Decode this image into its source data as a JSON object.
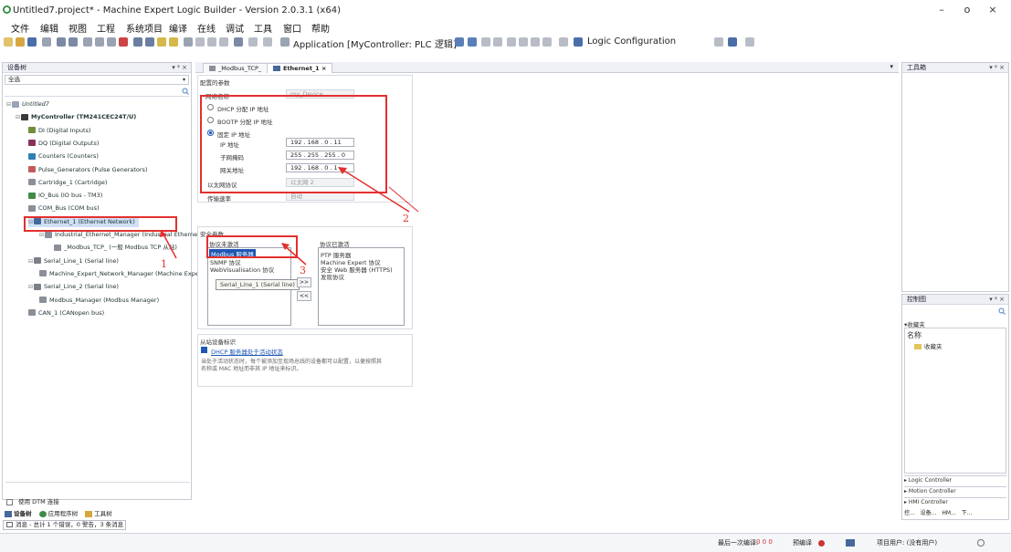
{
  "window": {
    "title": "Untitled7.project* - Machine Expert Logic Builder - Version 2.0.3.1 (x64)",
    "min": "–",
    "max": "o",
    "close": "×"
  },
  "menu": [
    "文件",
    "编辑",
    "视图",
    "工程",
    "系统项目",
    "编译",
    "在线",
    "调试",
    "工具",
    "窗口",
    "帮助"
  ],
  "toolbar": {
    "application": "Application [MyController: PLC 逻辑]",
    "logic_config": "Logic Configuration"
  },
  "left": {
    "title": "设备树",
    "controls": "▾ ᵠ ×",
    "filter": "全选",
    "tree": [
      {
        "label": "Untitled7",
        "level": 0,
        "icon": "project-icon",
        "color": "#9aa4b5"
      },
      {
        "label": "MyController (TM241CEC24T/U)",
        "level": 1,
        "icon": "controller-icon",
        "color": "#3a3a3a",
        "bold": true
      },
      {
        "label": "DI (Digital Inputs)",
        "level": 2,
        "icon": "di-icon",
        "color": "#6f8f3a"
      },
      {
        "label": "DQ (Digital Outputs)",
        "level": 2,
        "icon": "dq-icon",
        "color": "#8b2f5c"
      },
      {
        "label": "Counters (Counters)",
        "level": 2,
        "icon": "counter-icon",
        "color": "#2f7fb6"
      },
      {
        "label": "Pulse_Generators (Pulse Generators)",
        "level": 2,
        "icon": "pulse-icon",
        "color": "#c05a5a"
      },
      {
        "label": "Cartridge_1 (Cartridge)",
        "level": 2,
        "icon": "cartridge-icon",
        "color": "#8a8f99"
      },
      {
        "label": "IO_Bus (IO bus - TM3)",
        "level": 2,
        "icon": "iobus-icon",
        "color": "#3f8a45"
      },
      {
        "label": "COM_Bus (COM bus)",
        "level": 2,
        "icon": "combus-icon",
        "color": "#8a8f99"
      },
      {
        "label": "Ethernet_1 (Ethernet Network)",
        "level": 2,
        "icon": "ethernet-icon",
        "color": "#46689a"
      },
      {
        "label": "Industrial_Ethernet_Manager (Industrial Ethernet Ma",
        "level": 3,
        "icon": "manager-icon",
        "color": "#8a8f99"
      },
      {
        "label": "_Modbus_TCP_ (一般 Modbus TCP 从站)",
        "level": 4,
        "icon": "modbus-icon",
        "color": "#8a8f99"
      },
      {
        "label": "Serial_Line_1 (Serial line)",
        "level": 2,
        "icon": "serial-icon",
        "color": "#7b7f88"
      },
      {
        "label": "Machine_Expert_Network_Manager (Machine Expert",
        "level": 3,
        "icon": "manager-icon",
        "color": "#8a8f99"
      },
      {
        "label": "Serial_Line_2 (Serial line)",
        "level": 2,
        "icon": "serial-icon",
        "color": "#7b7f88"
      },
      {
        "label": "Modbus_Manager (Modbus Manager)",
        "level": 3,
        "icon": "manager-icon",
        "color": "#8a8f99"
      },
      {
        "label": "CAN_1 (CANopen bus)",
        "level": 2,
        "icon": "can-icon",
        "color": "#8a8f99"
      }
    ],
    "dtm_checkbox": "使用 DTM 连接",
    "bottom_tabs": [
      "设备树",
      "应用程序树",
      "工具树"
    ],
    "messages": "消息 - 总计 1 个错误，0 警告，3 条消息"
  },
  "editor": {
    "tabs": [
      "_Modbus_TCP_",
      "Ethernet_1"
    ],
    "config_title": "配置的参数",
    "network_name_label": "网络名称",
    "network_name_value": "my_Device",
    "dhcp": "DHCP 分配 IP 地址",
    "bootp": "BOOTP 分配 IP 地址",
    "fixed": "固定 IP 地址",
    "ip_label": "IP 地址",
    "ip_value": "192 . 168 . 0 . 11",
    "mask_label": "子网掩码",
    "mask_value": "255 . 255 . 255 . 0",
    "gw_label": "网关地址",
    "gw_value": "192 . 168 . 0 . 1",
    "eth_proto_label": "以太网协议",
    "eth_proto_value": "以太网 2",
    "speed_label": "传输速率",
    "speed_value": "自动",
    "security_title": "安全参数",
    "inactive_title": "协议未激活",
    "inactive_items": [
      "Modbus 服务器",
      "SNMP 协议",
      "WebVisualisation 协议"
    ],
    "active_title": "协议已激活",
    "active_items": [
      "PTP 服务器",
      "Machine Expert 协议",
      "安全 Web 服务器 (HTTPS)",
      "发现协议"
    ],
    "move_right": ">>",
    "move_left": "<<",
    "tooltip": "Serial_Line_1 (Serial line)",
    "slave_title": "从站设备标识",
    "dhcp_server": "DHCP 服务器处于活动状态",
    "dhcp_note_1": "当处于活动状态时，每个被添加至现场总线的设备都可以配置，以便按照其",
    "dhcp_note_2": "名称或 MAC 地址而非其 IP 地址来标识。"
  },
  "annotations": [
    "1",
    "2",
    "3"
  ],
  "right": {
    "toolbox_title": "工具箱",
    "ctrl_title": "控制图",
    "favorites_section": "▾收藏夹",
    "name_header": "名称",
    "favorites_item": "收藏夹",
    "controls": "▾ ᵠ ×",
    "bottom_items": [
      "▸ Logic Controller",
      "▸ Motion Controller",
      "▸ HMI Controller"
    ],
    "bottom_tabs": [
      "控...",
      "设备...",
      "HM...",
      "下..."
    ]
  },
  "status": {
    "last_compile": "最后一次编译:",
    "last_compile_counts": "0 0 0",
    "precompile": "预编译",
    "project_user": "项目用户: (没有用户)"
  },
  "colors": {
    "accent": "#1e57b4",
    "annotation": "#e3302f",
    "selected": "#cfe0f7"
  }
}
